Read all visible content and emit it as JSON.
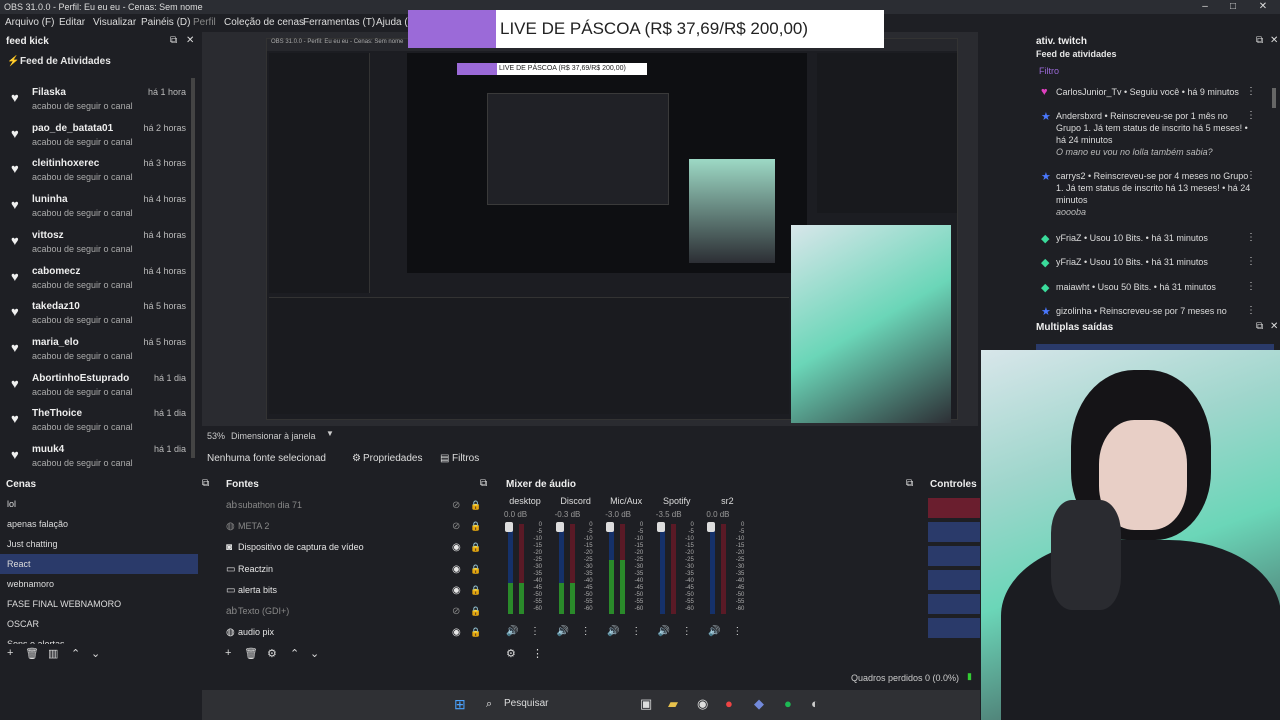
{
  "window": {
    "title": "OBS 31.0.0 - Perfil: Eu eu eu - Cenas: Sem nome"
  },
  "menu": [
    "Arquivo (F)",
    "Editar",
    "Visualizar",
    "Painéis (D)",
    "Perfil",
    "Coleção de cenas",
    "Ferramentas (T)",
    "Ajuda (H)"
  ],
  "banner": {
    "text": "LIVE DE PÁSCOA (R$ 37,69/R$ 200,00)",
    "inner_text": "LIVE DE PÁSCOA (R$ 37,69/R$ 200,00)",
    "accent": "#9b6ad8"
  },
  "feed_kick": {
    "dock_title": "feed kick",
    "header": "Feed de Atividades",
    "items": [
      {
        "name": "Filaska",
        "when": "há 1 hora",
        "sub": "acabou de seguir o canal"
      },
      {
        "name": "pao_de_batata01",
        "when": "há 2 horas",
        "sub": "acabou de seguir o canal"
      },
      {
        "name": "cleitinhoxerec",
        "when": "há 3 horas",
        "sub": "acabou de seguir o canal"
      },
      {
        "name": "luninha",
        "when": "há 4 horas",
        "sub": "acabou de seguir o canal"
      },
      {
        "name": "vittosz",
        "when": "há 4 horas",
        "sub": "acabou de seguir o canal"
      },
      {
        "name": "cabomecz",
        "when": "há 4 horas",
        "sub": "acabou de seguir o canal"
      },
      {
        "name": "takedaz10",
        "when": "há 5 horas",
        "sub": "acabou de seguir o canal"
      },
      {
        "name": "maria_elo",
        "when": "há 5 horas",
        "sub": "acabou de seguir o canal"
      },
      {
        "name": "AbortinhoEstuprado",
        "when": "há 1 dia",
        "sub": "acabou de seguir o canal"
      },
      {
        "name": "TheThoice",
        "when": "há 1 dia",
        "sub": "acabou de seguir o canal"
      },
      {
        "name": "muuk4",
        "when": "há 1 dia",
        "sub": "acabou de seguir o canal"
      }
    ]
  },
  "preview_status": {
    "zoom": "53%",
    "mode": "Dimensionar à janela"
  },
  "props_bar": {
    "no_source": "Nenhuma fonte selecionad",
    "properties": "Propriedades",
    "filters": "Filtros"
  },
  "scenes": {
    "title": "Cenas",
    "items": [
      "lol",
      "apenas falação",
      "Just chatting",
      "React",
      "webnamoro",
      "FASE FINAL WEBNAMORO",
      "OSCAR",
      "Sons e alertas"
    ],
    "selected_index": 3
  },
  "sources": {
    "title": "Fontes",
    "items": [
      {
        "name": "subathon dia 71",
        "icon": "text-icon",
        "dim": true
      },
      {
        "name": "META 2",
        "icon": "browser-icon",
        "dim": true
      },
      {
        "name": "Dispositivo de captura de vídeo",
        "icon": "camera-icon",
        "dim": false
      },
      {
        "name": "Reactzin",
        "icon": "window-icon",
        "dim": false
      },
      {
        "name": "alerta bits",
        "icon": "window-icon",
        "dim": false
      },
      {
        "name": "Texto (GDI+)",
        "icon": "text-icon",
        "dim": true
      },
      {
        "name": "audio pix",
        "icon": "browser-icon",
        "dim": false
      }
    ]
  },
  "mixer": {
    "title": "Mixer de áudio",
    "channels": [
      {
        "name": "desktop",
        "db": "0.0 dB",
        "level": 0.35
      },
      {
        "name": "Discord",
        "db": "-0.3 dB",
        "level": 0.35
      },
      {
        "name": "Mic/Aux",
        "db": "-3.0 dB",
        "level": 0.6
      },
      {
        "name": "Spotify",
        "db": "-3.5 dB",
        "level": 0.0
      },
      {
        "name": "sr2",
        "db": "0.0 dB",
        "level": 0.0
      }
    ],
    "scale": [
      "0",
      "-5",
      "-10",
      "-15",
      "-20",
      "-25",
      "-30",
      "-35",
      "-40",
      "-45",
      "-50",
      "-55",
      "-60"
    ]
  },
  "controls": {
    "title": "Controles"
  },
  "twitch": {
    "dock_title": "ativ. twitch",
    "header": "Feed de atividades",
    "filter": "Filtro",
    "items": [
      {
        "icon": "heart-icon",
        "text": "CarlosJunior_Tv • Seguiu você • há 9 minutos"
      },
      {
        "icon": "star-icon",
        "text": "Andersbxrd • Reinscreveu-se por 1 mês no Grupo 1. Já tem status de inscrito há 5 meses! • há 24 minutos",
        "note": "O mano eu vou no lolla também sabia?"
      },
      {
        "icon": "star-icon",
        "text": "carrys2 • Reinscreveu-se por 4 meses no Grupo 1. Já tem status de inscrito há 13 meses! • há 24 minutos",
        "note": "aoooba"
      },
      {
        "icon": "bits-icon",
        "text": "yFriaZ • Usou 10 Bits. • há 31 minutos"
      },
      {
        "icon": "bits-icon",
        "text": "yFriaZ • Usou 10 Bits. • há 31 minutos"
      },
      {
        "icon": "bits-icon",
        "text": "maiawht • Usou 50 Bits. • há 31 minutos"
      },
      {
        "icon": "star-icon",
        "text": "gizolinha • Reinscreveu-se por 7 meses no"
      }
    ]
  },
  "multiplas": {
    "title": "Multiplas saídas"
  },
  "footer": {
    "dropped": "Quadros perdidos 0 (0.0%)"
  },
  "taskbar": {
    "search": "Pesquisar"
  },
  "colors": {
    "selected": "#2a3a6a",
    "meter_bg": "#15316a",
    "meter_green": "#2a8a2a",
    "heart_twitch": "#e040c0",
    "star": "#4a78ff",
    "bits": "#3adb9b"
  }
}
